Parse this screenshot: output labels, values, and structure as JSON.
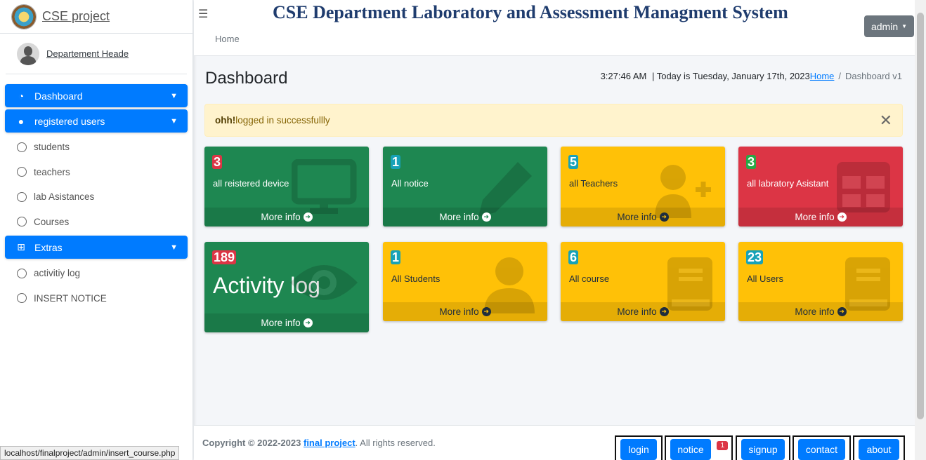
{
  "brand": {
    "name": "CSE project"
  },
  "user": {
    "name": "Departement Heade"
  },
  "sidebar": {
    "items": [
      {
        "label": "Dashboard",
        "type": "section"
      },
      {
        "label": "registered users",
        "type": "section"
      },
      {
        "label": "students",
        "type": "sub"
      },
      {
        "label": "teachers",
        "type": "sub"
      },
      {
        "label": "lab Asistances",
        "type": "sub"
      },
      {
        "label": "Courses",
        "type": "sub"
      },
      {
        "label": "Extras",
        "type": "section"
      },
      {
        "label": "activitiy log",
        "type": "sub"
      },
      {
        "label": "INSERT NOTICE",
        "type": "sub"
      }
    ]
  },
  "header": {
    "title": "CSE Department Laboratory and Assessment Managment System",
    "home": "Home",
    "admin": "admin"
  },
  "main": {
    "page_title": "Dashboard",
    "clock": "3:27:46 AM",
    "date_text": "| Today is Tuesday, January 17th, 2023",
    "breadcrumb_home": "Home",
    "breadcrumb_sep": "/",
    "breadcrumb_current": "Dashboard v1",
    "alert_strong": "ohh!",
    "alert_text": "logged in successfullly",
    "more_info": "More info"
  },
  "boxes": [
    {
      "count": "3",
      "label": "all reistered device",
      "color": "green",
      "icon": "desktop-icon"
    },
    {
      "count": "1",
      "label": "All notice",
      "color": "green",
      "icon": "pencil-icon"
    },
    {
      "count": "5",
      "label": "all Teachers",
      "color": "yellow",
      "icon": "user-plus-icon"
    },
    {
      "count": "3",
      "label": "all labratory Asistant",
      "color": "red",
      "icon": "table-icon"
    },
    {
      "count": "189",
      "label": "Activity log",
      "color": "green",
      "icon": "eye-icon"
    },
    {
      "count": "1",
      "label": "All Students",
      "color": "yellow",
      "icon": "user-icon"
    },
    {
      "count": "6",
      "label": "All course",
      "color": "yellow",
      "icon": "book-icon"
    },
    {
      "count": "23",
      "label": "All Users",
      "color": "yellow",
      "icon": "book-icon"
    }
  ],
  "footer": {
    "copyright_prefix": "Copyright © 2022-2023",
    "link": "final project",
    "suffix": ". All rights reserved.",
    "buttons": [
      "login",
      "notice",
      "signup",
      "contact",
      "about"
    ],
    "notice_badge": "1"
  },
  "status_url": "localhost/finalproject/admin/insert_course.php"
}
